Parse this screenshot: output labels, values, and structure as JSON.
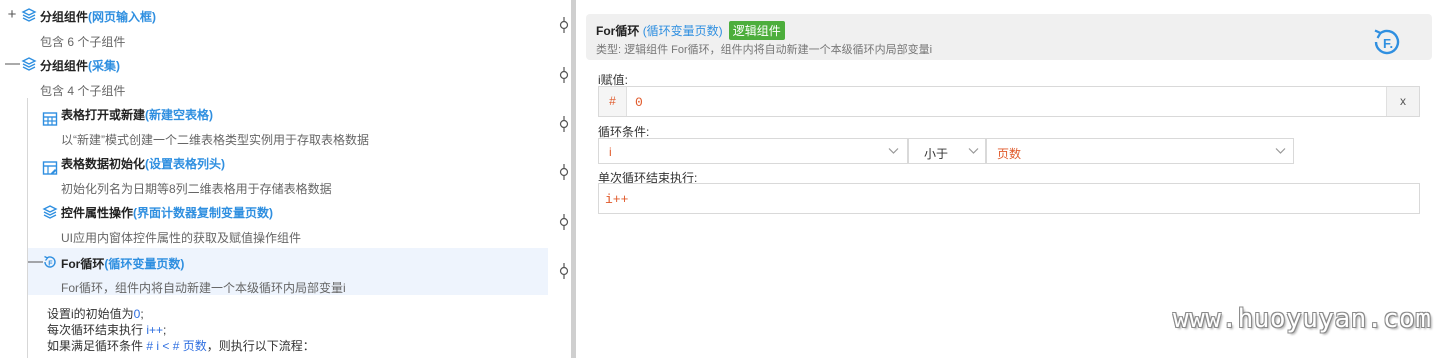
{
  "tree": {
    "nodes": [
      {
        "toggle": "+",
        "title": "分组组件",
        "paren": "(网页输入框)",
        "subtitle": "包含 6 个子组件",
        "icon": "layers-icon"
      },
      {
        "toggle": "—",
        "title": "分组组件",
        "paren": "(采集)",
        "subtitle": "包含 4 个子组件",
        "icon": "layers-icon"
      },
      {
        "toggle": "",
        "title": "表格打开或新建",
        "paren": "(新建空表格)",
        "subtitle": "以“新建”模式创建一个二维表格类型实例用于存取表格数据",
        "icon": "table-icon"
      },
      {
        "toggle": "",
        "title": "表格数据初始化",
        "paren": "(设置表格列头)",
        "subtitle": "初始化列名为日期等8列二维表格用于存储表格数据",
        "icon": "table-edit-icon"
      },
      {
        "toggle": "",
        "title": "控件属性操作",
        "paren": "(界面计数器复制变量页数)",
        "subtitle": "UI应用内窗体控件属性的获取及赋值操作组件",
        "icon": "layers-icon"
      },
      {
        "toggle": "—",
        "title": "For循环",
        "paren": "(循环变量页数)",
        "subtitle": "For循环，组件内将自动新建一个本级循环内局部变量i",
        "icon": "loop-icon"
      }
    ],
    "code": {
      "line1_a": "设置i的初始值为",
      "line1_b": "0",
      "line1_c": ";",
      "line2_a": "每次循环结束执行 ",
      "line2_b": "i++",
      "line2_c": ";",
      "line3_a": "如果满足循环条件 ",
      "line3_b": "# i < # 页数",
      "line3_c": "，则执行以下流程："
    }
  },
  "detail": {
    "title": "For循环",
    "paren": "(循环变量页数)",
    "badge": "逻辑组件",
    "desc": "类型:  逻辑组件 For循环，组件内将自动新建一个本级循环内局部变量i",
    "icon": "for-loop-icon",
    "init_label": "i赋值:",
    "init_hash": "#",
    "init_value": "0",
    "clear_label": "x",
    "cond_label": "循环条件:",
    "cond_var": "i",
    "cond_op": "小于",
    "cond_target": "页数",
    "step_label": "单次循环结束执行:",
    "step_value": "i++"
  },
  "colors": {
    "accent": "#2f8fe0",
    "badge": "#4cae3c",
    "value": "#e05a2b",
    "selected": "#eef4fd"
  },
  "watermark": "www.huoyuyan.com"
}
